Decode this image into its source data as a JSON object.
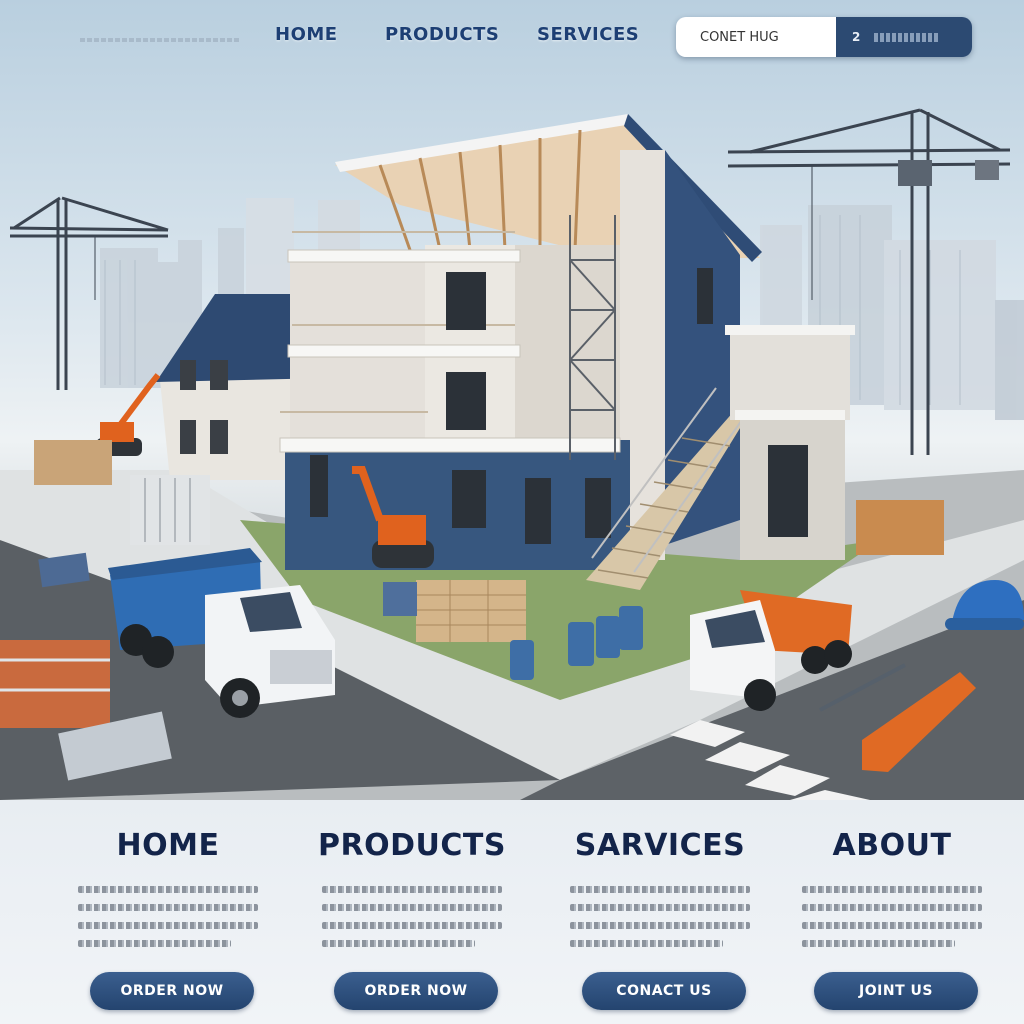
{
  "nav": {
    "links": [
      "HOME",
      "PRODUCTS",
      "SERVICES"
    ],
    "search": {
      "value": "CONET HUG",
      "button_number": "2"
    }
  },
  "hero": {
    "image_description": "Construction site illustration: partially built multi-storey house with scaffolding and stairs, tower cranes, city skyline, blue and white dump trucks, excavator, stacks of building materials, hard hat",
    "accent_color": "#1d3f74",
    "house_accent": "#37577f"
  },
  "cards": [
    {
      "title": "HOME",
      "button": "ORDER NOW"
    },
    {
      "title": "PRODUCTS",
      "button": "ORDER NOW"
    },
    {
      "title": "SARVICES",
      "button": "CONACT US"
    },
    {
      "title": "ABOUT",
      "button": "JOINT US"
    }
  ],
  "icons": {
    "search_button": "search-icon",
    "hard_hat": "hard-hat-icon"
  },
  "colors": {
    "nav_text": "#1d3f74",
    "card_title": "#13244a",
    "button_bg": "#2c4a72"
  }
}
